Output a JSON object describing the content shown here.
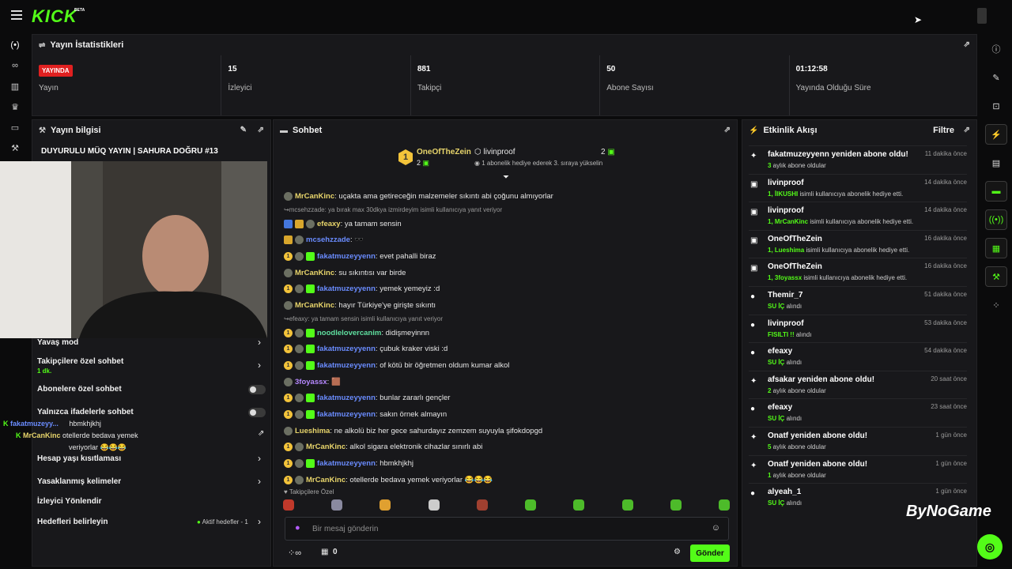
{
  "header": {
    "logo": "KICK",
    "beta": "BETA"
  },
  "stats": {
    "title": "Yayın İstatistikleri",
    "items": [
      {
        "value": "YAYINDA",
        "label": "Yayın"
      },
      {
        "value": "15",
        "label": "İzleyici"
      },
      {
        "value": "881",
        "label": "Takipçi"
      },
      {
        "value": "50",
        "label": "Abone Sayısı"
      },
      {
        "value": "01:12:58",
        "label": "Yayında Olduğu Süre"
      }
    ]
  },
  "info": {
    "title": "Yayın bilgisi",
    "stream_title": "DUYURULU MÜQ YAYIN | SAHURA DOĞRU #13",
    "settings": [
      {
        "label": "Yavaş mod"
      },
      {
        "label": "Takipçilere özel sohbet",
        "sub": "1 dk."
      },
      {
        "label": "Abonelere özel sohbet"
      },
      {
        "label": "Yalnızca ifadelerle sohbet"
      },
      {
        "label": "Hesap yaşı kısıtlaması"
      },
      {
        "label": "Yasaklanmış kelimeler"
      },
      {
        "label": "İzleyici Yönlendir"
      },
      {
        "label": "Hedefleri belirleyin",
        "extra": "Aktif hedefler - 1"
      }
    ],
    "overlay": {
      "u1": "fakatmuzeyy...",
      "m1": "hbmkhjkhj",
      "u2": "MrCanKinc",
      "m2": "otellerde bedava yemek",
      "m3": "veriyorlar"
    }
  },
  "chat": {
    "title": "Sohbet",
    "pinned": {
      "user1": "OneOfTheZein",
      "count1": "2",
      "user2": "livinproof",
      "count2": "2",
      "desc": "1 abonelik hediye ederek 3. sıraya yükselin"
    },
    "messages": [
      {
        "u": "MrCanKinc",
        "c": "uy",
        "t": ": uçakta ama getireceğin malzemeler sıkıntı abi çoğunu almıyorlar",
        "b": [
          "b2"
        ]
      },
      {
        "reply": "mcsehzzade: ya bırak max 30dkya izmirdeyim isimli kullanıcıya yanıt veriyor"
      },
      {
        "u": "efeaxy",
        "c": "uy",
        "t": ": ya tamam sensin",
        "b": [
          "b4",
          "b5",
          "b2"
        ]
      },
      {
        "u": "mcsehzzade",
        "c": "ub",
        "t": ": 🕶️",
        "b": [
          "b5",
          "b2"
        ]
      },
      {
        "u": "fakatmuzeyyenn",
        "c": "ub",
        "t": ": evet pahalli biraz",
        "b": [
          "b1",
          "b2",
          "b3"
        ]
      },
      {
        "u": "MrCanKinc",
        "c": "uy",
        "t": ": su sıkıntısı var birde",
        "b": [
          "b2"
        ]
      },
      {
        "u": "fakatmuzeyyenn",
        "c": "ub",
        "t": ": yemek yemeyiz :d",
        "b": [
          "b1",
          "b2",
          "b3"
        ]
      },
      {
        "u": "MrCanKinc",
        "c": "uy",
        "t": ": hayır Türkiye'ye girişte sıkıntı",
        "b": [
          "b2"
        ]
      },
      {
        "reply": "efeaxy: ya tamam sensin isimli kullanıcıya yanıt veriyor"
      },
      {
        "u": "noodlelovercanim",
        "c": "ug",
        "t": ": didişmeyinnn",
        "b": [
          "b1",
          "b2",
          "b3"
        ]
      },
      {
        "u": "fakatmuzeyyenn",
        "c": "ub",
        "t": ": çubuk kraker viski :d",
        "b": [
          "b1",
          "b2",
          "b3"
        ]
      },
      {
        "u": "fakatmuzeyyenn",
        "c": "ub",
        "t": ": of kötü bir öğretmen oldum kumar alkol",
        "b": [
          "b1",
          "b2",
          "b3"
        ]
      },
      {
        "u": "3foyassx",
        "c": "up",
        "t": ": 🟫",
        "b": [
          "b2"
        ]
      },
      {
        "u": "fakatmuzeyyenn",
        "c": "ub",
        "t": ": bunlar zararlı gençler",
        "b": [
          "b1",
          "b2",
          "b3"
        ]
      },
      {
        "u": "fakatmuzeyyenn",
        "c": "ub",
        "t": ": sakın örnek almayın",
        "b": [
          "b1",
          "b2",
          "b3"
        ]
      },
      {
        "u": "Lueshima",
        "c": "uy",
        "t": ": ne alkolü biz her gece sahurdayız zemzem suyuyla şifokdopgd",
        "b": [
          "b2"
        ]
      },
      {
        "u": "MrCanKinc",
        "c": "uy",
        "t": ": alkol sigara elektronik cihazlar sınırlı abi",
        "b": [
          "b1",
          "b2"
        ]
      },
      {
        "u": "fakatmuzeyyenn",
        "c": "ub",
        "t": ": hbmkhjkhj",
        "b": [
          "b1",
          "b2",
          "b3"
        ]
      },
      {
        "u": "MrCanKinc",
        "c": "uy",
        "t": ": otellerde bedava yemek veriyorlar 😂😂😂",
        "b": [
          "b1",
          "b2"
        ]
      }
    ],
    "followers_only": "Takipçilere Özel",
    "placeholder": "Bir mesaj gönderin",
    "points": "0",
    "send": "Gönder"
  },
  "events": {
    "title": "Etkinlik Akışı",
    "filter": "Filtre",
    "items": [
      {
        "name": "fakatmuzeyyenn yeniden abone oldu!",
        "hl": "3",
        "sub": " aylık abone oldular",
        "time": "11 dakika önce",
        "icon": "✦"
      },
      {
        "name": "livinproof",
        "hl": "1, İIKUSHI",
        "sub": " isimli kullanıcıya abonelik hediye etti.",
        "time": "14 dakika önce",
        "icon": "▣"
      },
      {
        "name": "livinproof",
        "hl": "1, MrCanKinc",
        "sub": " isimli kullanıcıya abonelik hediye etti.",
        "time": "14 dakika önce",
        "icon": "▣"
      },
      {
        "name": "OneOfTheZein",
        "hl": "1, Lueshima",
        "sub": " isimli kullanıcıya abonelik hediye etti.",
        "time": "16 dakika önce",
        "icon": "▣"
      },
      {
        "name": "OneOfTheZein",
        "hl": "1, 3foyassx",
        "sub": " isimli kullanıcıya abonelik hediye etti.",
        "time": "16 dakika önce",
        "icon": "▣"
      },
      {
        "name": "Themir_7",
        "hl": "SU İÇ",
        "sub": " alındı",
        "time": "51 dakika önce",
        "icon": "●"
      },
      {
        "name": "livinproof",
        "hl": "FISILTI !!",
        "sub": " alındı",
        "time": "53 dakika önce",
        "icon": "●"
      },
      {
        "name": "efeaxy",
        "hl": "SU İÇ",
        "sub": " alındı",
        "time": "54 dakika önce",
        "icon": "●"
      },
      {
        "name": "afsakar yeniden abone oldu!",
        "hl": "2",
        "sub": " aylık abone oldular",
        "time": "20 saat önce",
        "icon": "✦"
      },
      {
        "name": "efeaxy",
        "hl": "SU İÇ",
        "sub": " alındı",
        "time": "23 saat önce",
        "icon": "●"
      },
      {
        "name": "Onatf yeniden abone oldu!",
        "hl": "5",
        "sub": " aylık abone oldular",
        "time": "1 gün önce",
        "icon": "✦"
      },
      {
        "name": "Onatf yeniden abone oldu!",
        "hl": "1",
        "sub": " aylık abone oldular",
        "time": "1 gün önce",
        "icon": "✦"
      },
      {
        "name": "alyeah_1",
        "hl": "SU İÇ",
        "sub": " alındı",
        "time": "1 gün önce",
        "icon": "●"
      }
    ]
  },
  "watermark": "ByNoGame"
}
